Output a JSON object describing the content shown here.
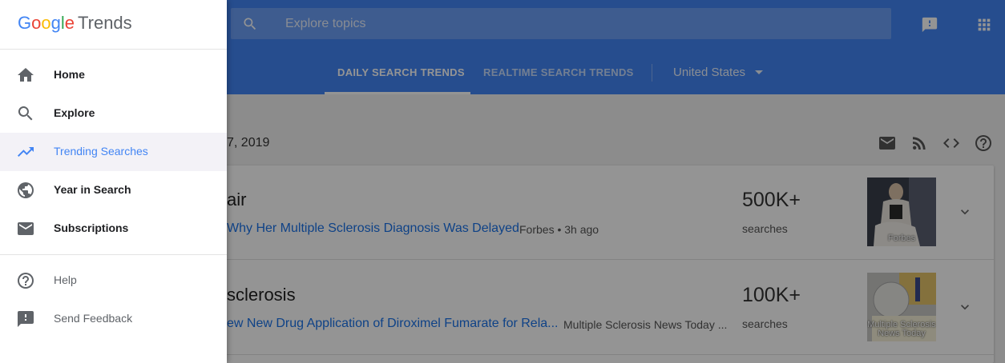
{
  "app": {
    "logo_letters": [
      "G",
      "o",
      "o",
      "g",
      "l",
      "e"
    ],
    "logo_product": "Trends"
  },
  "search": {
    "placeholder": "Explore topics"
  },
  "tabs": [
    {
      "label": "DAILY SEARCH TRENDS",
      "active": true
    },
    {
      "label": "REALTIME SEARCH TRENDS",
      "active": false
    }
  ],
  "country": {
    "selected": "United States"
  },
  "content": {
    "date_fragment": "7, 2019",
    "toolbar_icons": [
      "email-icon",
      "rss-icon",
      "embed-code-icon",
      "help-icon"
    ],
    "trends": [
      {
        "title_fragment": "air",
        "article_fragment": "Why Her Multiple Sclerosis Diagnosis Was Delayed",
        "source": "Forbes • 3h ago",
        "count": "500K+",
        "count_label": "searches",
        "thumb_caption": "Forbes"
      },
      {
        "title_fragment": "sclerosis",
        "article_fragment": "ew New Drug Application of Diroximel Fumarate for Rela...",
        "source": "Multiple Sclerosis News Today ...",
        "count": "100K+",
        "count_label": "searches",
        "thumb_caption": "Multiple Sclerosis News Today"
      }
    ]
  },
  "drawer": {
    "primary": [
      {
        "label": "Home",
        "icon": "home-icon",
        "active": false
      },
      {
        "label": "Explore",
        "icon": "search-icon",
        "active": false
      },
      {
        "label": "Trending Searches",
        "icon": "trending-up-icon",
        "active": true
      },
      {
        "label": "Year in Search",
        "icon": "globe-icon",
        "active": false
      },
      {
        "label": "Subscriptions",
        "icon": "mail-icon",
        "active": false
      }
    ],
    "secondary": [
      {
        "label": "Help",
        "icon": "help-circle-icon"
      },
      {
        "label": "Send Feedback",
        "icon": "feedback-icon"
      }
    ]
  },
  "colors": {
    "header_blue": "#4285f4",
    "active_blue": "#4285f4",
    "link_blue": "#1a73e8"
  }
}
